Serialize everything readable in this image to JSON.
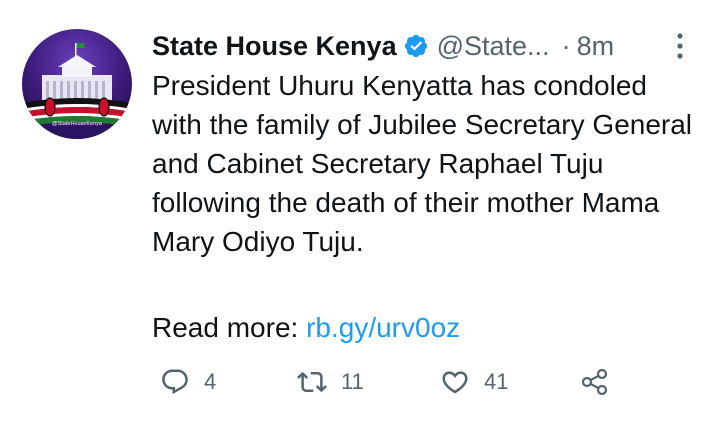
{
  "tweet": {
    "author_name": "State House Kenya",
    "handle": "@State...",
    "separator": "·",
    "time": "8m",
    "avatar_watermark": "@StateHouseKenya",
    "text": "President Uhuru Kenyatta has condoled with the family of Jubilee Secretary General and Cabinet Secretary Raphael Tuju following the death of their mother Mama Mary Odiyo Tuju.",
    "read_more_label": "Read more:",
    "link": "rb.gy/urv0oz"
  },
  "actions": {
    "replies": "4",
    "retweets": "11",
    "likes": "41"
  },
  "icons": {
    "verified": "verified-badge-icon",
    "more": "more-icon",
    "reply": "reply-icon",
    "retweet": "retweet-icon",
    "like": "like-icon",
    "share": "share-icon"
  },
  "colors": {
    "text": "#0f1419",
    "secondary": "#536471",
    "link": "#1d9bf0",
    "verified": "#1d9bf0",
    "avatar_bg": "#3b1a78"
  }
}
